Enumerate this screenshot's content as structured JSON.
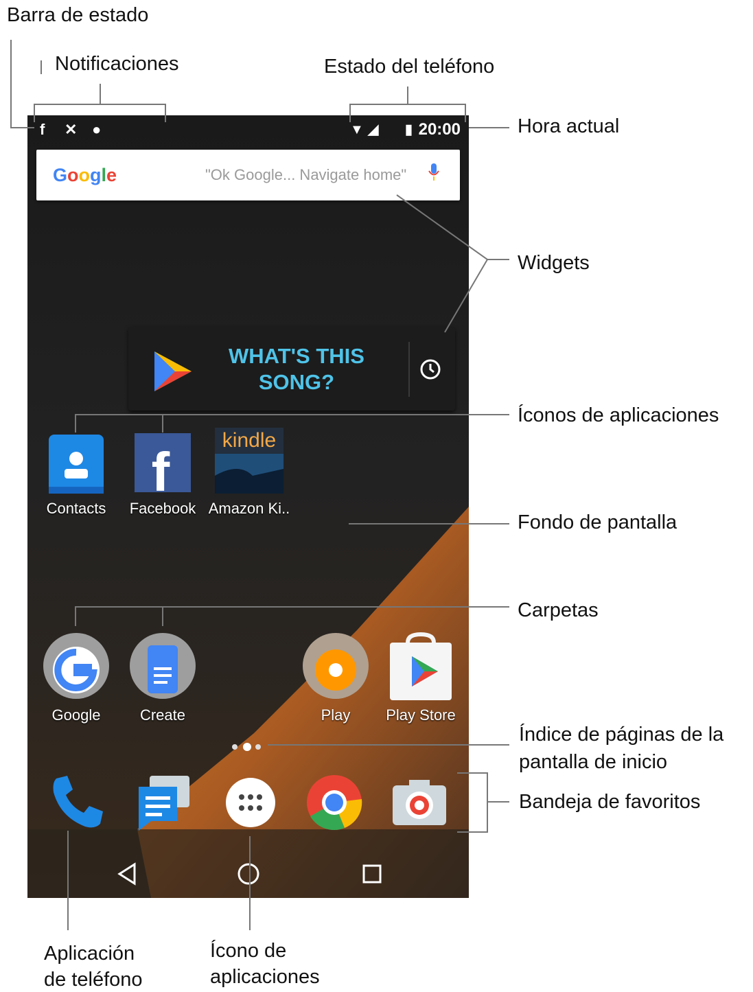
{
  "labels": {
    "status_bar": "Barra de estado",
    "notifications": "Notificaciones",
    "phone_status": "Estado del teléfono",
    "current_time": "Hora actual",
    "widgets": "Widgets",
    "app_icons": "Íconos de aplicaciones",
    "wallpaper": "Fondo de pantalla",
    "folders": "Carpetas",
    "page_index_line1": "Índice de páginas de la",
    "page_index_line2": "pantalla de inicio",
    "favorites_tray": "Bandeja de favoritos",
    "phone_app_line1": "Aplicación",
    "phone_app_line2": "de teléfono",
    "apps_icon_line1": "Ícono de",
    "apps_icon_line2": "aplicaciones"
  },
  "phone": {
    "time": "20:00",
    "search_logo": "Google",
    "search_hint": "\"Ok Google... Navigate home\"",
    "song_widget_line1": "WHAT'S THIS",
    "song_widget_line2": "SONG?",
    "row1_apps": [
      "Contacts",
      "Facebook",
      "Amazon Ki.."
    ],
    "kindle_logo": "kindle",
    "row2_apps": [
      "Google",
      "Create",
      "Play",
      "Play Store"
    ],
    "page_dots": 3,
    "active_page_dot": 2,
    "dock_icons": [
      "phone-icon",
      "messages-icon",
      "app-drawer-icon",
      "chrome-icon",
      "camera-icon"
    ],
    "nav_icons": [
      "back-icon",
      "home-icon",
      "recents-icon"
    ]
  }
}
